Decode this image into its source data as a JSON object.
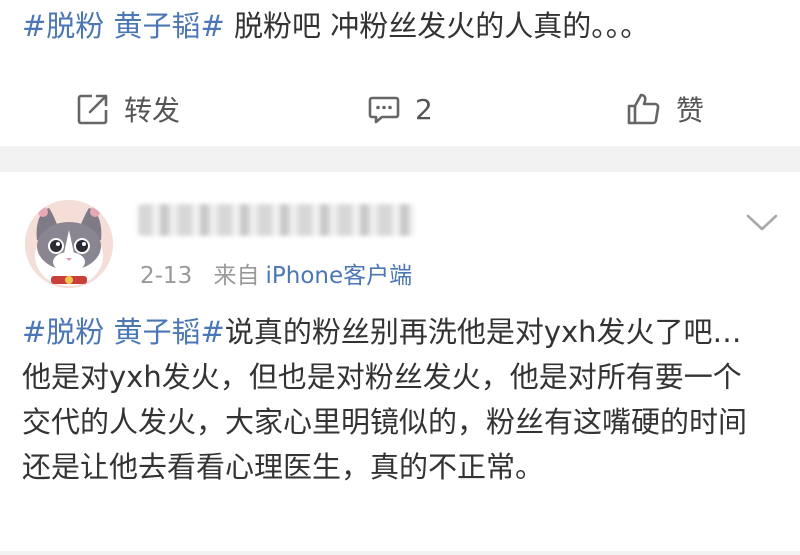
{
  "post": {
    "tag": "#脱粉 黄子韬#",
    "text": " 脱粉吧 冲粉丝发火的人真的。。。"
  },
  "actions": {
    "repost_label": "转发",
    "comment_count": "2",
    "like_label": "赞"
  },
  "comment": {
    "date": "2-13",
    "from_label": "来自",
    "source": "iPhone客户端",
    "tag": "#脱粉 黄子韬#",
    "text": "说真的粉丝别再洗他是对yxh发火了吧…他是对yxh发火，但也是对粉丝发火，他是对所有要一个交代的人发火，大家心里明镜似的，粉丝有这嘴硬的时间还是让他去看看心理医生，真的不正常。"
  },
  "colors": {
    "link": "#4b77b4",
    "text": "#333333",
    "meta": "#999999",
    "separator": "#f2f2f2"
  },
  "icons": [
    "repost-icon",
    "comment-icon",
    "like-icon",
    "chevron-down-icon",
    "avatar"
  ]
}
